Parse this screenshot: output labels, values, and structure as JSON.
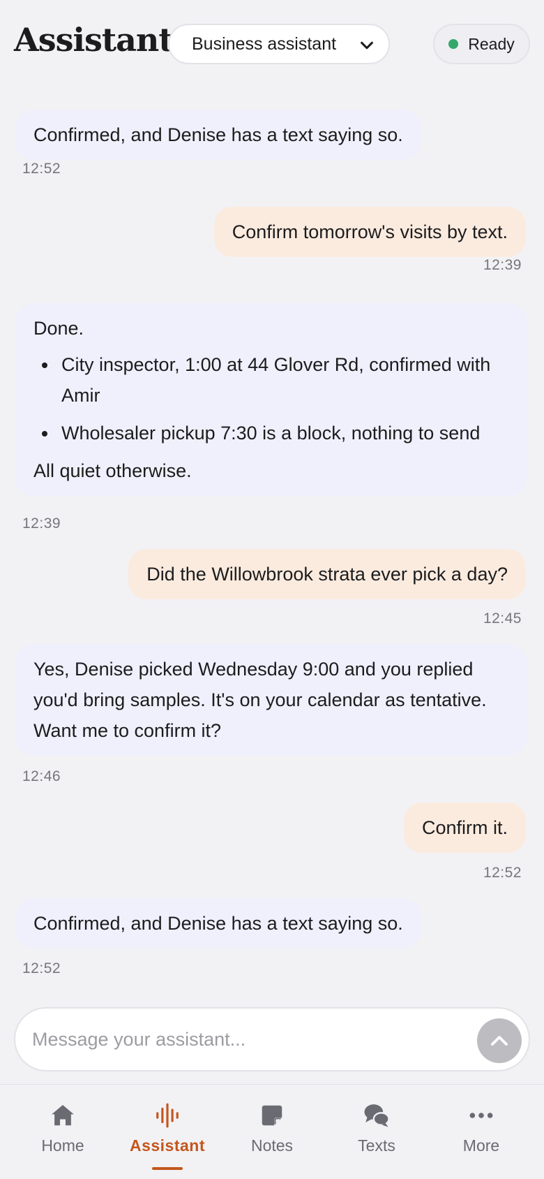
{
  "header": {
    "title": "Assistant",
    "mode": {
      "selected": "Business assistant",
      "icon": "chevron-down-icon"
    },
    "status": {
      "label": "Ready",
      "color": "#34a86b"
    }
  },
  "chat": {
    "top_partial_timestamp": "12:52",
    "messages": [
      {
        "role": "bot",
        "text": "Confirmed, and Denise has a text saying so.",
        "time": "12:52"
      },
      {
        "role": "user",
        "text": "Confirm tomorrow's visits by text.",
        "time": "12:39"
      },
      {
        "role": "bot",
        "intro": "Done.",
        "bullets": [
          "City inspector, 1:00 at 44 Glover Rd, confirmed with Amir",
          "Wholesaler pickup 7:30 is a block, nothing to send"
        ],
        "outro": "All quiet otherwise.",
        "time": "12:39"
      },
      {
        "role": "user",
        "text": "Did the Willowbrook strata ever pick a day?",
        "time": "12:45"
      },
      {
        "role": "bot",
        "text": "Yes, Denise picked Wednesday 9:00 and you replied you'd bring samples. It's on your calendar as tentative. Want me to confirm it?",
        "time": "12:46"
      },
      {
        "role": "user",
        "text": "Confirm it.",
        "time": "12:52"
      },
      {
        "role": "bot",
        "text": "Confirmed, and Denise has a text saying so.",
        "time": "12:52"
      }
    ]
  },
  "composer": {
    "placeholder": "Message your assistant...",
    "send_icon": "chevron-up-icon"
  },
  "tabbar": {
    "accent": "#c4561c",
    "items": [
      {
        "label": "Home",
        "icon": "home-icon"
      },
      {
        "label": "Assistant",
        "icon": "waveform-icon",
        "active": true
      },
      {
        "label": "Notes",
        "icon": "note-icon"
      },
      {
        "label": "Texts",
        "icon": "chat-bubbles-icon"
      },
      {
        "label": "More",
        "icon": "more-dots-icon"
      }
    ]
  }
}
